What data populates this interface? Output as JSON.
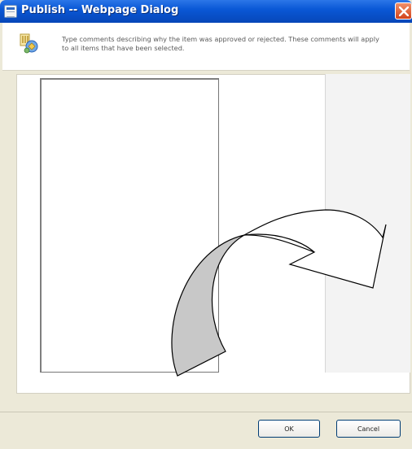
{
  "window": {
    "title": "Publish -- Webpage Dialog"
  },
  "header": {
    "instructions": "Type comments describing why the item was approved or rejected. These comments will apply to all items that have been selected."
  },
  "comments": {
    "value": ""
  },
  "buttons": {
    "ok_label": "OK",
    "cancel_label": "Cancel"
  },
  "icons": {
    "title": "page-icon",
    "header": "publish-icon",
    "close": "close-icon"
  },
  "colors": {
    "titlebar": "#0a58d6",
    "close_button": "#d2431b",
    "dialog_background": "#ece9d8"
  }
}
